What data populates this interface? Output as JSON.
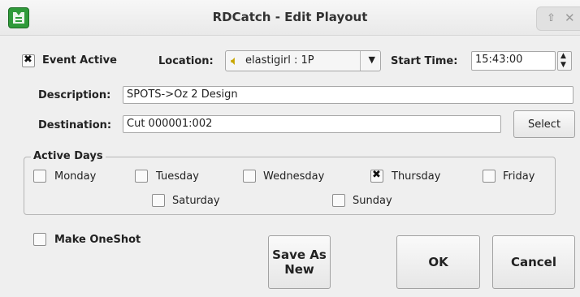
{
  "window": {
    "title": "RDCatch - Edit Playout"
  },
  "event_active": {
    "label": "Event Active",
    "checked": true
  },
  "location": {
    "label": "Location:",
    "value": "elastigirl : 1P"
  },
  "start_time": {
    "label": "Start Time:",
    "value": "15:43:00"
  },
  "description": {
    "label": "Description:",
    "value": "SPOTS->Oz 2 Design"
  },
  "destination": {
    "label": "Destination:",
    "value": "Cut 000001:002",
    "select_label": "Select"
  },
  "active_days": {
    "title": "Active Days",
    "days": [
      {
        "label": "Monday",
        "checked": false
      },
      {
        "label": "Tuesday",
        "checked": false
      },
      {
        "label": "Wednesday",
        "checked": false
      },
      {
        "label": "Thursday",
        "checked": true
      },
      {
        "label": "Friday",
        "checked": false
      },
      {
        "label": "Saturday",
        "checked": false
      },
      {
        "label": "Sunday",
        "checked": false
      }
    ]
  },
  "make_oneshot": {
    "label": "Make OneShot",
    "checked": false
  },
  "buttons": {
    "save_as_new_line1": "Save As",
    "save_as_new_line2": "New",
    "ok": "OK",
    "cancel": "Cancel"
  }
}
